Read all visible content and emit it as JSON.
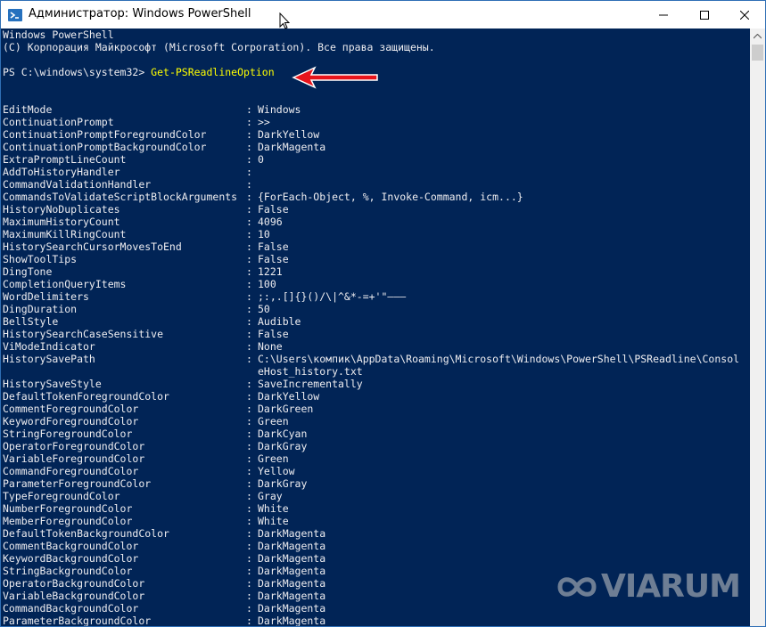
{
  "window": {
    "title": "Администратор: Windows PowerShell",
    "controls": {
      "minimize": "minimize",
      "maximize": "maximize",
      "close": "close"
    }
  },
  "console": {
    "header_line1": "Windows PowerShell",
    "header_line2": "(C) Корпорация Майкрософт (Microsoft Corporation). Все права защищены.",
    "prompt": "PS C:\\windows\\system32> ",
    "command": "Get-PSReadlineOption",
    "options": [
      {
        "key": "EditMode",
        "value": "Windows"
      },
      {
        "key": "ContinuationPrompt",
        "value": ">>"
      },
      {
        "key": "ContinuationPromptForegroundColor",
        "value": "DarkYellow"
      },
      {
        "key": "ContinuationPromptBackgroundColor",
        "value": "DarkMagenta"
      },
      {
        "key": "ExtraPromptLineCount",
        "value": "0"
      },
      {
        "key": "AddToHistoryHandler",
        "value": ""
      },
      {
        "key": "CommandValidationHandler",
        "value": ""
      },
      {
        "key": "CommandsToValidateScriptBlockArguments",
        "value": "{ForEach-Object, %, Invoke-Command, icm...}"
      },
      {
        "key": "HistoryNoDuplicates",
        "value": "False"
      },
      {
        "key": "MaximumHistoryCount",
        "value": "4096"
      },
      {
        "key": "MaximumKillRingCount",
        "value": "10"
      },
      {
        "key": "HistorySearchCursorMovesToEnd",
        "value": "False"
      },
      {
        "key": "ShowToolTips",
        "value": "False"
      },
      {
        "key": "DingTone",
        "value": "1221"
      },
      {
        "key": "CompletionQueryItems",
        "value": "100"
      },
      {
        "key": "WordDelimiters",
        "value": ";:,.[]{}()/\\|^&*-=+'\"–—―"
      },
      {
        "key": "DingDuration",
        "value": "50"
      },
      {
        "key": "BellStyle",
        "value": "Audible"
      },
      {
        "key": "HistorySearchCaseSensitive",
        "value": "False"
      },
      {
        "key": "ViModeIndicator",
        "value": "None"
      },
      {
        "key": "HistorySavePath",
        "value": "C:\\Users\\компик\\AppData\\Roaming\\Microsoft\\Windows\\PowerShell\\PSReadline\\Consol",
        "value2": "eHost_history.txt"
      },
      {
        "key": "HistorySaveStyle",
        "value": "SaveIncrementally"
      },
      {
        "key": "DefaultTokenForegroundColor",
        "value": "DarkYellow"
      },
      {
        "key": "CommentForegroundColor",
        "value": "DarkGreen"
      },
      {
        "key": "KeywordForegroundColor",
        "value": "Green"
      },
      {
        "key": "StringForegroundColor",
        "value": "DarkCyan"
      },
      {
        "key": "OperatorForegroundColor",
        "value": "DarkGray"
      },
      {
        "key": "VariableForegroundColor",
        "value": "Green"
      },
      {
        "key": "CommandForegroundColor",
        "value": "Yellow"
      },
      {
        "key": "ParameterForegroundColor",
        "value": "DarkGray"
      },
      {
        "key": "TypeForegroundColor",
        "value": "Gray"
      },
      {
        "key": "NumberForegroundColor",
        "value": "White"
      },
      {
        "key": "MemberForegroundColor",
        "value": "White"
      },
      {
        "key": "DefaultTokenBackgroundColor",
        "value": "DarkMagenta"
      },
      {
        "key": "CommentBackgroundColor",
        "value": "DarkMagenta"
      },
      {
        "key": "KeywordBackgroundColor",
        "value": "DarkMagenta"
      },
      {
        "key": "StringBackgroundColor",
        "value": "DarkMagenta"
      },
      {
        "key": "OperatorBackgroundColor",
        "value": "DarkMagenta"
      },
      {
        "key": "VariableBackgroundColor",
        "value": "DarkMagenta"
      },
      {
        "key": "CommandBackgroundColor",
        "value": "DarkMagenta"
      },
      {
        "key": "ParameterBackgroundColor",
        "value": "DarkMagenta"
      }
    ]
  },
  "watermark": {
    "text": "VIARUM",
    "icon": "viarum-logo-icon"
  },
  "colors": {
    "console_bg": "#012456",
    "console_fg": "#eeedf0",
    "command": "#ffff00",
    "annotation_arrow": "#e8141b"
  }
}
